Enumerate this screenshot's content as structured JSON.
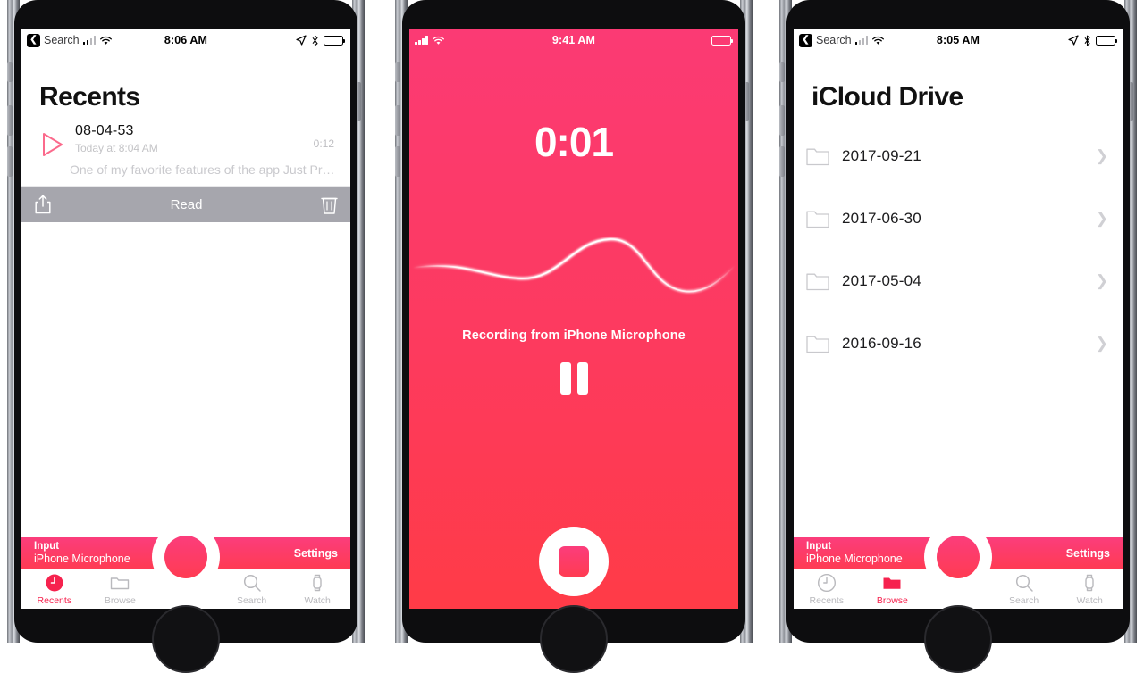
{
  "phones": [
    {
      "id": "recents",
      "status_bar": {
        "back_label": "Search",
        "time": "8:06 AM",
        "icons": [
          "back-chevron",
          "cellular-bars",
          "wifi",
          "location-arrow",
          "bluetooth",
          "battery"
        ]
      },
      "title": "Recents",
      "recording": {
        "name": "08-04-53",
        "subtitle": "Today at 8:04 AM",
        "duration": "0:12",
        "transcript": "One of my favorite features of the app Just Pr…",
        "play_icon": "play-triangle-icon"
      },
      "swipe_actions": {
        "share_icon": "share-icon",
        "label": "Read",
        "delete_icon": "trash-icon"
      },
      "input_bar": {
        "key": "Input",
        "value": "iPhone Microphone",
        "settings": "Settings"
      },
      "tabs": [
        {
          "label": "Recents",
          "icon": "clock-icon",
          "active": true
        },
        {
          "label": "Browse",
          "icon": "folder-icon",
          "active": false
        },
        {
          "label": "Search",
          "icon": "magnifier-icon",
          "active": false
        },
        {
          "label": "Watch",
          "icon": "watch-icon",
          "active": false
        }
      ],
      "record_button": "record-button"
    },
    {
      "id": "recording",
      "status_bar": {
        "time": "9:41 AM",
        "icons": [
          "cellular-bars",
          "wifi",
          "battery"
        ]
      },
      "timer": "0:01",
      "status_text": "Recording from iPhone Microphone",
      "pause_button": "pause-button",
      "stop_button": "stop-button"
    },
    {
      "id": "browse",
      "status_bar": {
        "back_label": "Search",
        "time": "8:05 AM",
        "icons": [
          "back-chevron",
          "cellular-bars",
          "wifi",
          "location-arrow",
          "bluetooth",
          "battery"
        ]
      },
      "title": "iCloud Drive",
      "folders": [
        {
          "name": "2017-09-21",
          "icon": "folder-icon"
        },
        {
          "name": "2017-06-30",
          "icon": "folder-icon"
        },
        {
          "name": "2017-05-04",
          "icon": "folder-icon"
        },
        {
          "name": "2016-09-16",
          "icon": "folder-icon"
        }
      ],
      "input_bar": {
        "key": "Input",
        "value": "iPhone Microphone",
        "settings": "Settings"
      },
      "tabs": [
        {
          "label": "Recents",
          "icon": "clock-icon",
          "active": false
        },
        {
          "label": "Browse",
          "icon": "folder-icon",
          "active": true
        },
        {
          "label": "Search",
          "icon": "magnifier-icon",
          "active": false
        },
        {
          "label": "Watch",
          "icon": "watch-icon",
          "active": false
        }
      ],
      "record_button": "record-button"
    }
  ],
  "colors": {
    "accent_pink": "#f6224e",
    "gradient_top": "#fb3a74",
    "gradient_bottom": "#ff3b47",
    "action_bar_gray": "#a6a6ad",
    "inactive_gray": "#b9b9bd"
  }
}
